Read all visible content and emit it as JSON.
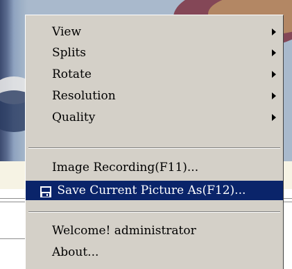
{
  "menu": {
    "items": [
      {
        "label": "View",
        "has_submenu": true
      },
      {
        "label": "Splits",
        "has_submenu": true
      },
      {
        "label": "Rotate",
        "has_submenu": true
      },
      {
        "label": "Resolution",
        "has_submenu": true
      },
      {
        "label": "Quality",
        "has_submenu": true
      },
      {
        "label": "Image Recording(F11)...",
        "has_submenu": false
      },
      {
        "label": "Save Current Picture As(F12)...",
        "has_submenu": false,
        "highlighted": true,
        "icon": "floppy-disk-icon"
      },
      {
        "label": "Welcome! administrator",
        "has_submenu": false
      },
      {
        "label": "About...",
        "has_submenu": false
      }
    ]
  },
  "colors": {
    "menu_background": "#d4d0c8",
    "highlight_background": "#0a246a",
    "highlight_text": "#ffffff",
    "text": "#000000"
  }
}
